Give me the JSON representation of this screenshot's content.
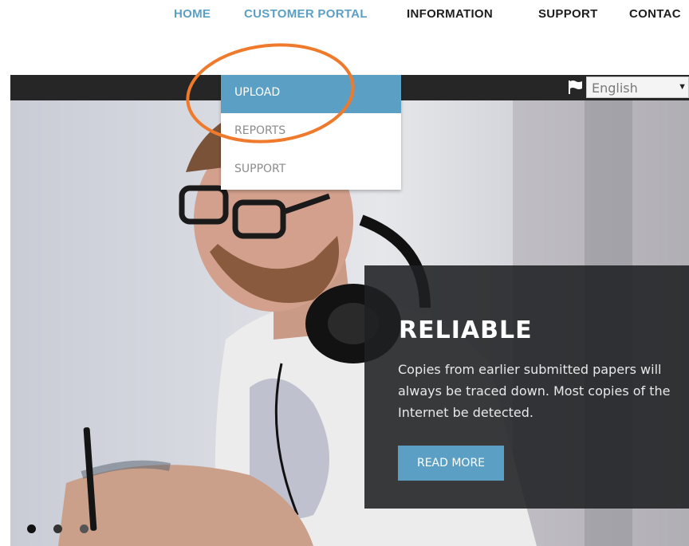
{
  "nav": {
    "items": [
      {
        "label": "HOME"
      },
      {
        "label": "CUSTOMER PORTAL"
      },
      {
        "label": "INFORMATION"
      },
      {
        "label": "SUPPORT"
      },
      {
        "label": "CONTAC"
      }
    ]
  },
  "language": {
    "selected": "English",
    "icon": "flag-icon"
  },
  "dropdown": {
    "items": [
      {
        "label": "UPLOAD",
        "active": true
      },
      {
        "label": "REPORTS"
      },
      {
        "label": "SUPPORT"
      }
    ]
  },
  "slide": {
    "title": "RELIABLE",
    "body": "Copies from earlier submitted papers will always be traced down. Most copies of the Internet be detected.",
    "button": "READ MORE"
  },
  "slider": {
    "dot_count": 3,
    "active_index": 0
  },
  "colors": {
    "accent": "#5b9fc4",
    "nav_dark": "#1e1e1e",
    "topbar": "#262626",
    "annotation": "#f07a2b"
  }
}
